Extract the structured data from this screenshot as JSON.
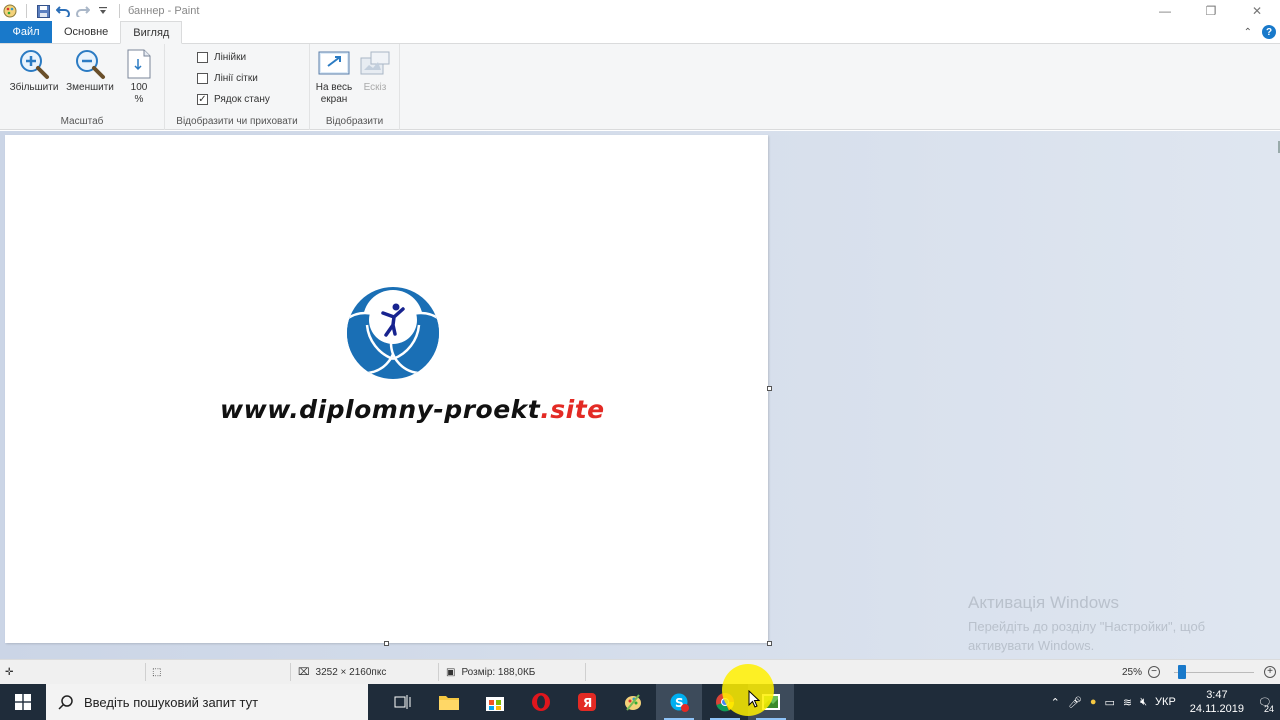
{
  "titlebar": {
    "title": "баннер - Paint",
    "minimize_icon": "minimize-icon",
    "maximize_icon": "restore-icon",
    "close_icon": "close-icon"
  },
  "tabs": {
    "file": "Файл",
    "home": "Основне",
    "view": "Вигляд"
  },
  "ribbon": {
    "zoom_group": {
      "label": "Масштаб",
      "zoom_in": "Збільшити",
      "zoom_out": "Зменшити",
      "hundred_top": "100",
      "hundred_bottom": "%"
    },
    "show_group": {
      "label": "Відобразити чи приховати",
      "rulers": "Лінійки",
      "rulers_checked": false,
      "gridlines": "Лінії сітки",
      "gridlines_checked": false,
      "statusbar": "Рядок стану",
      "statusbar_checked": true
    },
    "display_group": {
      "label": "Відобразити",
      "fullscreen_top": "На весь",
      "fullscreen_bottom": "екран",
      "thumbnail": "Ескіз"
    }
  },
  "canvas": {
    "site_main": "www.diplomny-proekt",
    "site_suffix": ".site",
    "accent_blue": "#1a6fb5",
    "accent_red": "#e32a24"
  },
  "activation": {
    "heading": "Активація Windows",
    "line1": "Перейдіть до розділу \"Настройки\", щоб",
    "line2": "активувати Windows."
  },
  "status": {
    "dimensions": "3252 × 2160пкс",
    "size": "Розмір: 188,0КБ",
    "zoom": "25%",
    "zoom_fraction": 0.1
  },
  "taskbar": {
    "search_placeholder": "Введіть пошуковий запит тут",
    "language": "УКР",
    "time": "3:47",
    "date": "24.11.2019",
    "notifications": "24"
  }
}
